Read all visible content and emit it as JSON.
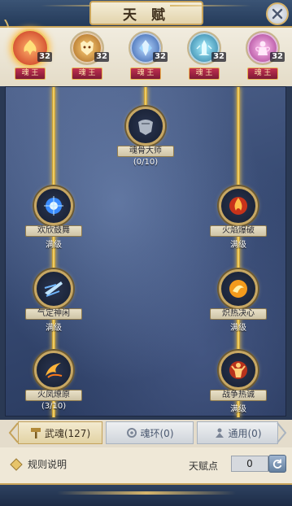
{
  "header": {
    "title": "天 赋"
  },
  "souls": [
    {
      "level": "32",
      "rank": "魂 王",
      "icon": "phoenix-icon",
      "color": "#e2452c",
      "selected": true
    },
    {
      "level": "32",
      "rank": "魂 王",
      "icon": "beast-icon",
      "color": "#d89a2c"
    },
    {
      "level": "32",
      "rank": "魂 王",
      "icon": "crystal-icon",
      "color": "#3a7fe0"
    },
    {
      "level": "32",
      "rank": "魂 王",
      "icon": "tower-icon",
      "color": "#38b2d8"
    },
    {
      "level": "32",
      "rank": "魂 王",
      "icon": "fairy-icon",
      "color": "#d958b8"
    }
  ],
  "tree": {
    "nodes": [
      {
        "name": "魂骨大师",
        "progress": "(0/10)",
        "icon": "armor-icon"
      },
      {
        "name": "欢欣鼓舞",
        "progress": "满级",
        "icon": "energy-orb-icon"
      },
      {
        "name": "火焰爆破",
        "progress": "满级",
        "icon": "fire-burst-icon"
      },
      {
        "name": "气定神闲",
        "progress": "满级",
        "icon": "wind-blade-icon"
      },
      {
        "name": "炽热决心",
        "progress": "满级",
        "icon": "fire-orb-icon"
      },
      {
        "name": "火凤燎原",
        "progress": "(3/10)",
        "icon": "flame-wing-icon"
      },
      {
        "name": "战争热诚",
        "progress": "满级",
        "icon": "warrior-flame-icon"
      }
    ]
  },
  "tabs": [
    {
      "label": "武魂(127)",
      "icon": "hammer-icon",
      "active": true
    },
    {
      "label": "魂环(0)",
      "icon": "ring-icon"
    },
    {
      "label": "通用(0)",
      "icon": "person-icon"
    }
  ],
  "bottom": {
    "rules_label": "规则说明",
    "points_label": "天赋点",
    "points_value": "0"
  },
  "colors": {
    "gold": "#c9a45a",
    "accent_line": "#ffe27a",
    "rank_red": "#c23050"
  }
}
